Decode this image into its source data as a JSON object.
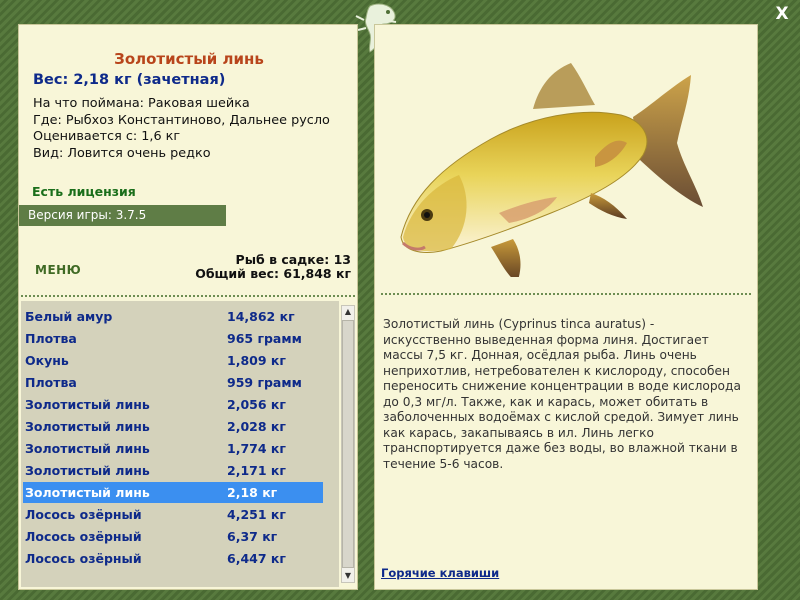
{
  "fish": {
    "title": "Золотистый линь",
    "weight_line": "Вес: 2,18 кг (зачетная)",
    "info": [
      "На что поймана: Раковая шейка",
      "Где: Рыбхоз Константиново, Дальнее русло",
      "Оценивается с: 1,6 кг",
      "Вид: Ловится очень редко"
    ],
    "license": "Есть лицензия",
    "version": "Версия игры: 3.7.5"
  },
  "menu_label": "МЕНЮ",
  "cage": {
    "count_line": "Рыб в садке: 13",
    "total_line": "Общий вес: 61,848 кг"
  },
  "catch_list": [
    {
      "name": "Белый амур",
      "weight": "14,862 кг"
    },
    {
      "name": "Плотва",
      "weight": "965 грамм"
    },
    {
      "name": "Окунь",
      "weight": "1,809 кг"
    },
    {
      "name": "Плотва",
      "weight": "959 грамм"
    },
    {
      "name": "Золотистый линь",
      "weight": "2,056 кг"
    },
    {
      "name": "Золотистый линь",
      "weight": "2,028 кг"
    },
    {
      "name": "Золотистый линь",
      "weight": "1,774 кг"
    },
    {
      "name": "Золотистый линь",
      "weight": "2,171 кг"
    },
    {
      "name": "Золотистый линь",
      "weight": "2,18 кг",
      "selected": true
    },
    {
      "name": "Лосось озёрный",
      "weight": "4,251 кг"
    },
    {
      "name": "Лосось озёрный",
      "weight": "6,37 кг"
    },
    {
      "name": "Лосось озёрный",
      "weight": "6,447 кг"
    }
  ],
  "description": "Золотистый линь (Cyprinus tinca auratus) - искусственно выведенная форма линя. Достигает массы 7,5 кг. Донная, осёдлая рыба. Линь очень неприхотлив, нетребователен к кислороду, способен переносить снижение концентрации в воде кислорода до 0,3 мг/л. Также, как и карась, может обитать в заболоченных водоёмах с кислой средой. Зимует линь как карась, закапываясь в ил. Линь легко транспортируется даже без воды, во влажной ткани в течение 5-6 часов.",
  "hotkeys_label": "Горячие клавиши",
  "close_label": "X",
  "colors": {
    "frame": "#4f6f37",
    "panel": "#f8f6d8",
    "selected_row": "#3b8ff0",
    "list_text": "#0e2a8a",
    "title": "#b8451b"
  },
  "icons": [
    "lizard-logo-icon",
    "close-icon",
    "chevron-up-icon",
    "chevron-down-icon",
    "fish-illustration"
  ]
}
